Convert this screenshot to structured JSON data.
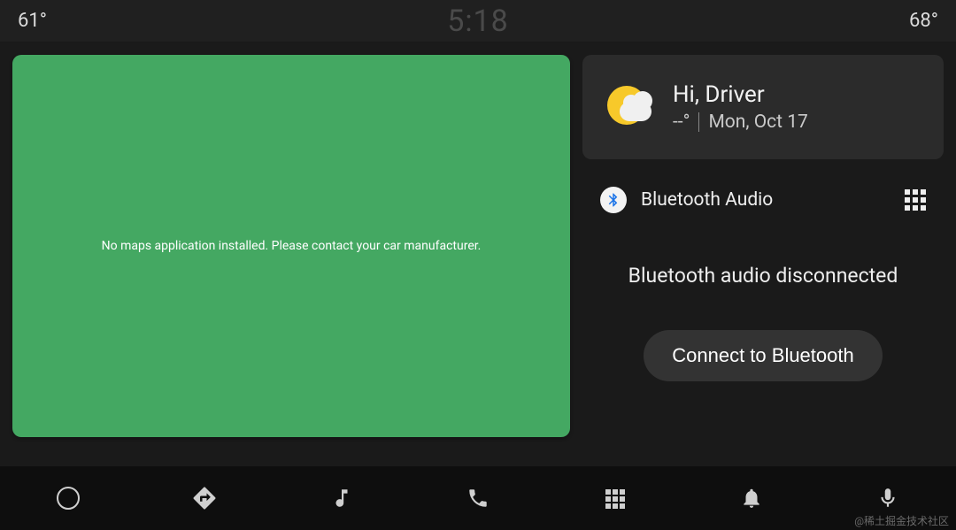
{
  "statusbar": {
    "temp_left": "61°",
    "clock": "5:18",
    "temp_right": "68°"
  },
  "map": {
    "message": "No maps application installed. Please contact your car manufacturer."
  },
  "greeting": {
    "title": "Hi, Driver",
    "temp": "--°",
    "date": "Mon, Oct 17"
  },
  "bluetooth": {
    "title": "Bluetooth Audio",
    "status": "Bluetooth audio disconnected",
    "button": "Connect to Bluetooth"
  },
  "watermark": "@稀土掘金技术社区"
}
